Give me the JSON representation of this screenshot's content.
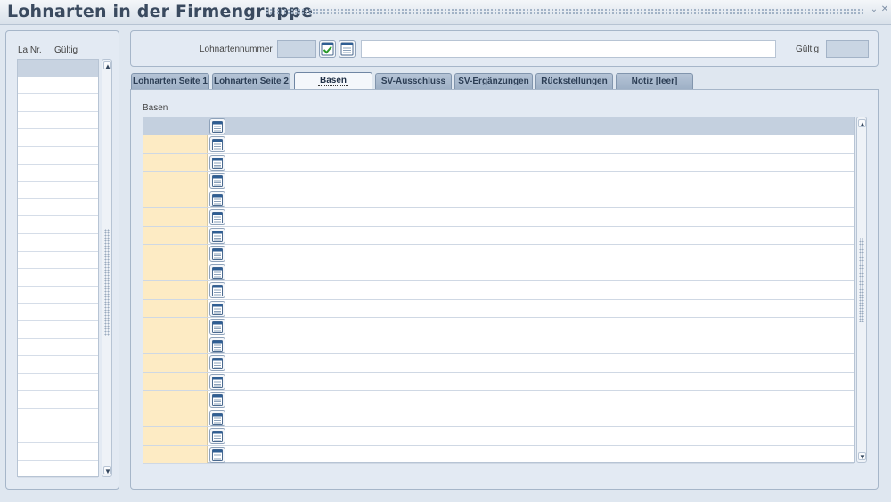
{
  "window": {
    "title": "Lohnarten in der Firmengruppe",
    "minimize_glyph": "⌄",
    "close_glyph": "✕"
  },
  "left_list": {
    "columns": [
      "La.Nr.",
      "Gültig"
    ],
    "row_count": 24,
    "selected_row": 0
  },
  "header": {
    "lohnartennummer_label": "Lohnartennummer",
    "lohnartennummer_value": "",
    "name_value": "",
    "gueltig_label": "Gültig",
    "gueltig_value": "",
    "icons": [
      "check-calendar-icon",
      "calendar-list-icon"
    ]
  },
  "tabs": [
    {
      "label": "Lohnarten Seite 1",
      "active": false
    },
    {
      "label": "Lohnarten Seite 2",
      "active": false
    },
    {
      "label": "Basen",
      "active": true
    },
    {
      "label": "SV-Ausschluss",
      "active": false
    },
    {
      "label": "SV-Ergänzungen",
      "active": false
    },
    {
      "label": "Rückstellungen",
      "active": false
    },
    {
      "label": "Notiz [leer]",
      "active": false
    }
  ],
  "basen": {
    "section_label": "Basen",
    "row_count": 18,
    "row_icon": "calculator-icon"
  },
  "colors": {
    "background": "#dfe7f0",
    "panel": "#e3eaf3",
    "header_row": "#c4d0df",
    "key_cell": "#fdebc4",
    "tab": "#a9b9ce",
    "active_tab": "#f4f7fb"
  }
}
